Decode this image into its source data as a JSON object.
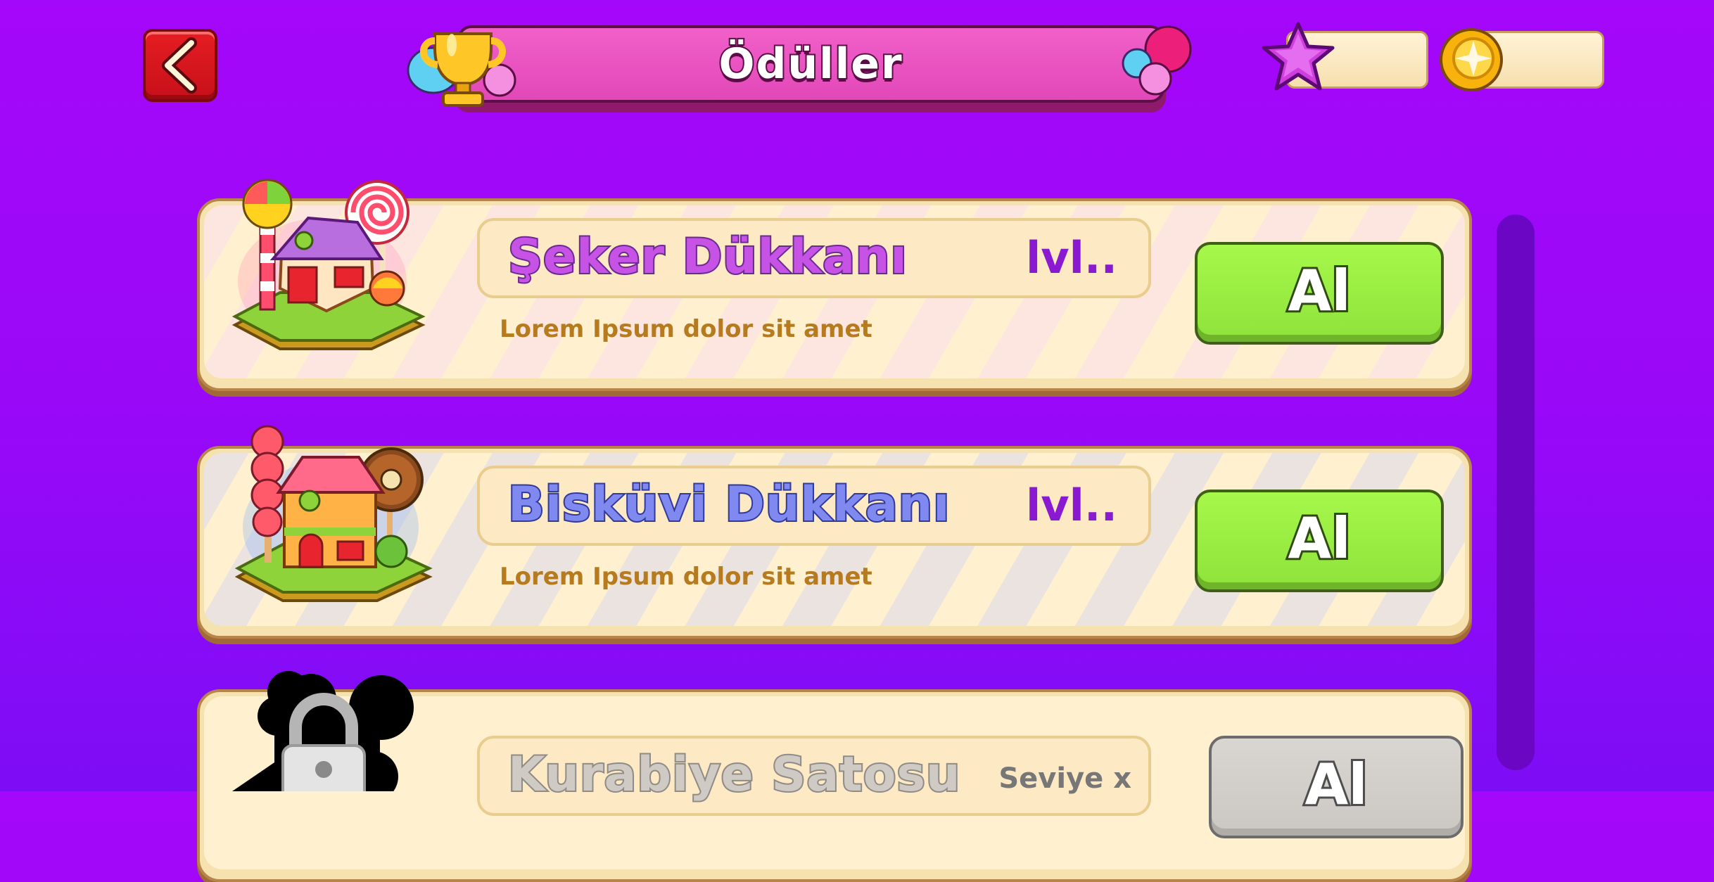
{
  "header": {
    "title": "Ödüller",
    "back_icon": "chevron-left-icon",
    "trophy_icon": "trophy-icon",
    "star_value": "",
    "coin_value": ""
  },
  "colors": {
    "background": "#a407f9",
    "banner": "#e248b8",
    "buy_button": "#a6f84a",
    "card": "#fff0cf"
  },
  "rewards": [
    {
      "name": "Şeker Dükkanı",
      "level": "lvl..",
      "description": "Lorem Ipsum dolor sit amet",
      "button": "Al",
      "name_color": "#c653e6",
      "locked": false
    },
    {
      "name": "Bisküvi Dükkanı",
      "level": "lvl..",
      "description": "Lorem Ipsum dolor sit amet",
      "button": "Al",
      "name_color": "#7f89f0",
      "locked": false
    },
    {
      "name": "Kurabiye Satosu",
      "level": "Seviye x",
      "description": "",
      "button": "Al",
      "name_color": "#cfcac4",
      "locked": true
    }
  ]
}
